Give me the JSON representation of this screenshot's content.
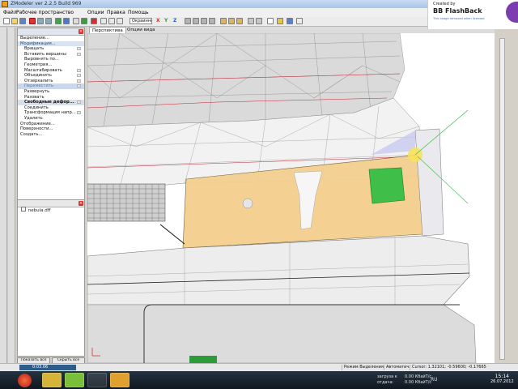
{
  "window": {
    "title": "ZModeler ver 2.2.5  Build 969"
  },
  "menu": [
    "Файл",
    "Рабочее пространство",
    "Опции",
    "Правка",
    "Помощь"
  ],
  "toolbar": {
    "view_mode": "Окраинне",
    "axes": [
      "X",
      "Y",
      "Z"
    ]
  },
  "ops_panel": {
    "items": [
      {
        "label": "Выделение...",
        "style": "normal"
      },
      {
        "label": "Модификация...",
        "style": "section"
      },
      {
        "label": "Вращать",
        "style": "indent",
        "check": true
      },
      {
        "label": "Вставить вершины",
        "style": "indent",
        "check": true
      },
      {
        "label": "Выровнять по...",
        "style": "indent"
      },
      {
        "label": "Геометрия...",
        "style": "indent"
      },
      {
        "label": "Масштабировать",
        "style": "indent",
        "check": true
      },
      {
        "label": "Объединить",
        "style": "indent",
        "check": true
      },
      {
        "label": "Отзеркалить",
        "style": "indent",
        "check": true
      },
      {
        "label": "Переместить",
        "style": "active",
        "check": true
      },
      {
        "label": "Развернуть",
        "style": "indent"
      },
      {
        "label": "Разовать",
        "style": "indent"
      },
      {
        "label": "Свободные дефор...",
        "style": "selected",
        "check": true
      },
      {
        "label": "Соединить",
        "style": "indent"
      },
      {
        "label": "Трансформация напр...",
        "style": "indent",
        "check": true
      },
      {
        "label": "Удалить",
        "style": "indent"
      },
      {
        "label": "Отображение...",
        "style": "normal"
      },
      {
        "label": "Поверхности...",
        "style": "normal"
      },
      {
        "label": "Создать...",
        "style": "normal"
      }
    ]
  },
  "tree": {
    "node": "nebula.dff"
  },
  "bottom_buttons": {
    "show_all": "Показать все",
    "hide_all": "Скрыть все"
  },
  "viewport": {
    "tabs": [
      "Перспектива",
      "Опции вида"
    ]
  },
  "status": {
    "time": "0:03.06",
    "mode": "Режим Выделения",
    "auto": "Автоматич.",
    "cursor": "Cursor: 1.32101; -0.59600; -0.17665"
  },
  "watermark": {
    "created_by": "Created by",
    "brand": "BB FlashBack",
    "note": "This image removed when licensed"
  },
  "taskbar": {
    "load_label": "загруза к",
    "give_label": "отдача:",
    "load_value": "0.00 КбайТ/с",
    "give_value": "0.00 КбайТ/с",
    "lang": "RU",
    "time": "15:14",
    "date": "26.07.2012"
  },
  "colors": {
    "taskbar": "#1a2530",
    "accent": "#2d5c8a",
    "panel": "#d4d0c8"
  }
}
